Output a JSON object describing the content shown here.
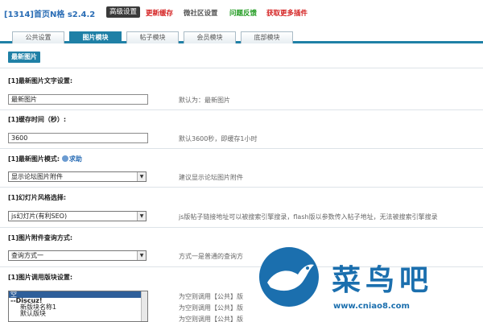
{
  "header": {
    "title": "[1314]首页N格 s2.4.2",
    "advanced_btn": "高级设置",
    "links": {
      "refresh_cache": "更新缓存",
      "community_settings": "微社区设置",
      "feedback": "问题反馈",
      "more_plugins": "获取更多插件"
    }
  },
  "tabs": [
    "公共设置",
    "图片模块",
    "帖子模块",
    "会员模块",
    "底部模块"
  ],
  "section": {
    "badge": "最新图片"
  },
  "form": {
    "text_setting": {
      "label": "[1]最新图片文字设置:",
      "value": "最新图片",
      "hint": "默认为：最新图片"
    },
    "cache_time": {
      "label": "[1]缓存时间（秒）:",
      "value": "3600",
      "hint": "默认3600秒，即缓存1小时"
    },
    "mode": {
      "label": "[1]最新图片模式:",
      "help": "求助",
      "selected": "显示论坛图片附件",
      "hint": "建议显示论坛图片附件"
    },
    "slide_style": {
      "label": "[1]幻灯片风格选择:",
      "selected": "js幻灯片(有利SEO)",
      "hint": "js版帖子链接地址可以被搜索引擎搜录，flash版以参数传入帖子地址，无法被搜索引擎搜录"
    },
    "query_mode": {
      "label": "[1]图片附件查询方式:",
      "selected": "查询方式一",
      "hint": "方式一是普通的查询方"
    },
    "block_setting": {
      "label": "[1]图片调用版块设置:",
      "options": [
        {
          "text": "空",
          "kind": "selected"
        },
        {
          "text": "--Discuz!",
          "kind": "group"
        },
        {
          "text": "新版块名称1",
          "kind": "sub"
        },
        {
          "text": "默认版块",
          "kind": "sub"
        }
      ],
      "hints": [
        "为空则调用【公共】版",
        "为空则调用【公共】版",
        "为空则调用【公共】版"
      ]
    }
  },
  "watermark": {
    "text": "菜鸟吧",
    "url": "www.cniao8.com"
  },
  "colors": {
    "accent": "#1f80a6",
    "link_blue": "#2a6db5",
    "red": "#d42020",
    "green": "#1e9a1e"
  }
}
